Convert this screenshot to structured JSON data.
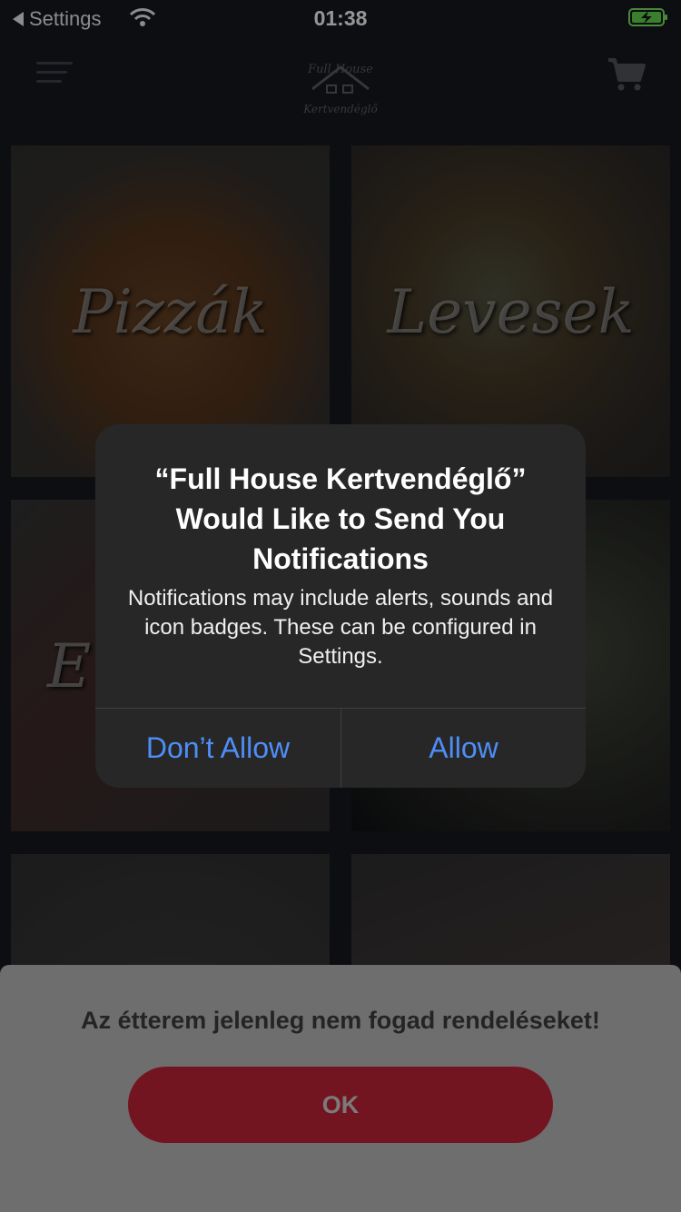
{
  "status_bar": {
    "back_label": "Settings",
    "time": "01:38",
    "battery_icon": "battery-charging-icon",
    "wifi_icon": "wifi-icon"
  },
  "header": {
    "menu_icon": "hamburger-menu-icon",
    "logo": {
      "line1": "Full House",
      "line2": "Kertvendéglő"
    },
    "cart_icon": "cart-icon"
  },
  "categories": [
    {
      "label": "Pizzák"
    },
    {
      "label": "Levesek"
    },
    {
      "label": "E"
    },
    {
      "label": ""
    },
    {
      "label": ""
    },
    {
      "label": ""
    }
  ],
  "alert": {
    "title": "“Full House Kertvendéglő” Would Like to Send You Notifications",
    "message": "Notifications may include alerts, sounds and icon badges. These can be configured in Settings.",
    "deny_label": "Don’t Allow",
    "allow_label": "Allow",
    "button_color": "#4e8ef7"
  },
  "sheet": {
    "message": "Az étterem jelenleg nem fogad rendeléseket!",
    "ok_label": "OK",
    "ok_color": "#731520"
  }
}
